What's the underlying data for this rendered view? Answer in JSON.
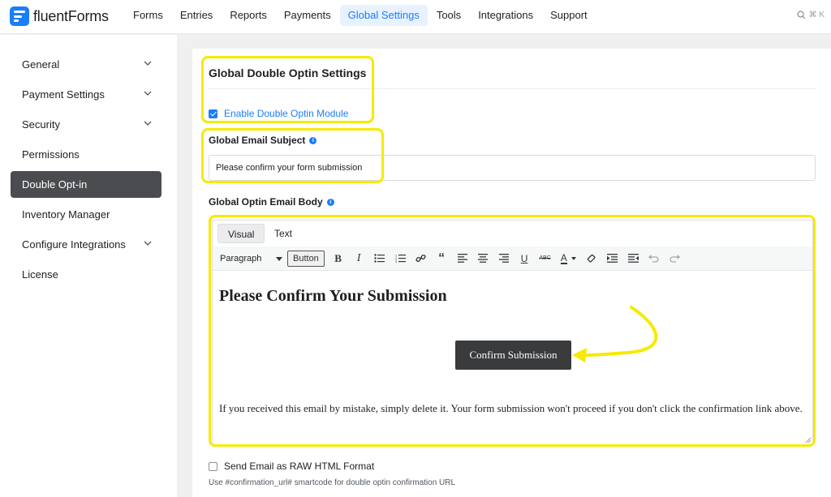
{
  "brand": {
    "name_light": "fluent",
    "name_bold": "Forms",
    "accent": "#1a7efb",
    "highlight": "#f6ea00"
  },
  "nav": {
    "items": [
      {
        "label": "Forms"
      },
      {
        "label": "Entries"
      },
      {
        "label": "Reports"
      },
      {
        "label": "Payments"
      },
      {
        "label": "Global Settings",
        "active": true
      },
      {
        "label": "Tools"
      },
      {
        "label": "Integrations"
      },
      {
        "label": "Support"
      }
    ],
    "search_shortcut": "⌘ K",
    "search_icon": "search-icon"
  },
  "sidebar": {
    "items": [
      {
        "label": "General",
        "expandable": true
      },
      {
        "label": "Payment Settings",
        "expandable": true
      },
      {
        "label": "Security",
        "expandable": true
      },
      {
        "label": "Permissions",
        "expandable": false
      },
      {
        "label": "Double Opt-in",
        "expandable": false,
        "active": true
      },
      {
        "label": "Inventory Manager",
        "expandable": false
      },
      {
        "label": "Configure Integrations",
        "expandable": true
      },
      {
        "label": "License",
        "expandable": false
      }
    ]
  },
  "settings": {
    "title": "Global Double Optin Settings",
    "enable_module": {
      "label": "Enable Double Optin Module",
      "checked": true
    },
    "subject": {
      "label": "Global Email Subject",
      "value": "Please confirm your form submission"
    },
    "body_label": "Global Optin Email Body",
    "editor": {
      "tabs": [
        {
          "label": "Visual",
          "active": true
        },
        {
          "label": "Text"
        }
      ],
      "format_select": "Paragraph",
      "button_tool": "Button",
      "toolbar_icons": [
        "bold-icon",
        "italic-icon",
        "bullet-list-icon",
        "numbered-list-icon",
        "link-icon",
        "blockquote-icon",
        "align-left-icon",
        "align-center-icon",
        "align-right-icon",
        "underline-icon",
        "strikethrough-icon",
        "text-color-icon",
        "clear-formatting-icon",
        "indent-icon",
        "outdent-icon",
        "undo-icon",
        "redo-icon"
      ],
      "content": {
        "heading": "Please Confirm Your Submission",
        "button": "Confirm Submission",
        "paragraph": "If you received this email by mistake, simply delete it. Your form submission won't proceed if you don't click the confirmation link above."
      }
    },
    "raw_html": {
      "label": "Send Email as RAW HTML Format",
      "checked": false
    },
    "help": "Use #confirmation_url# smartcode for double optin confirmation URL"
  }
}
